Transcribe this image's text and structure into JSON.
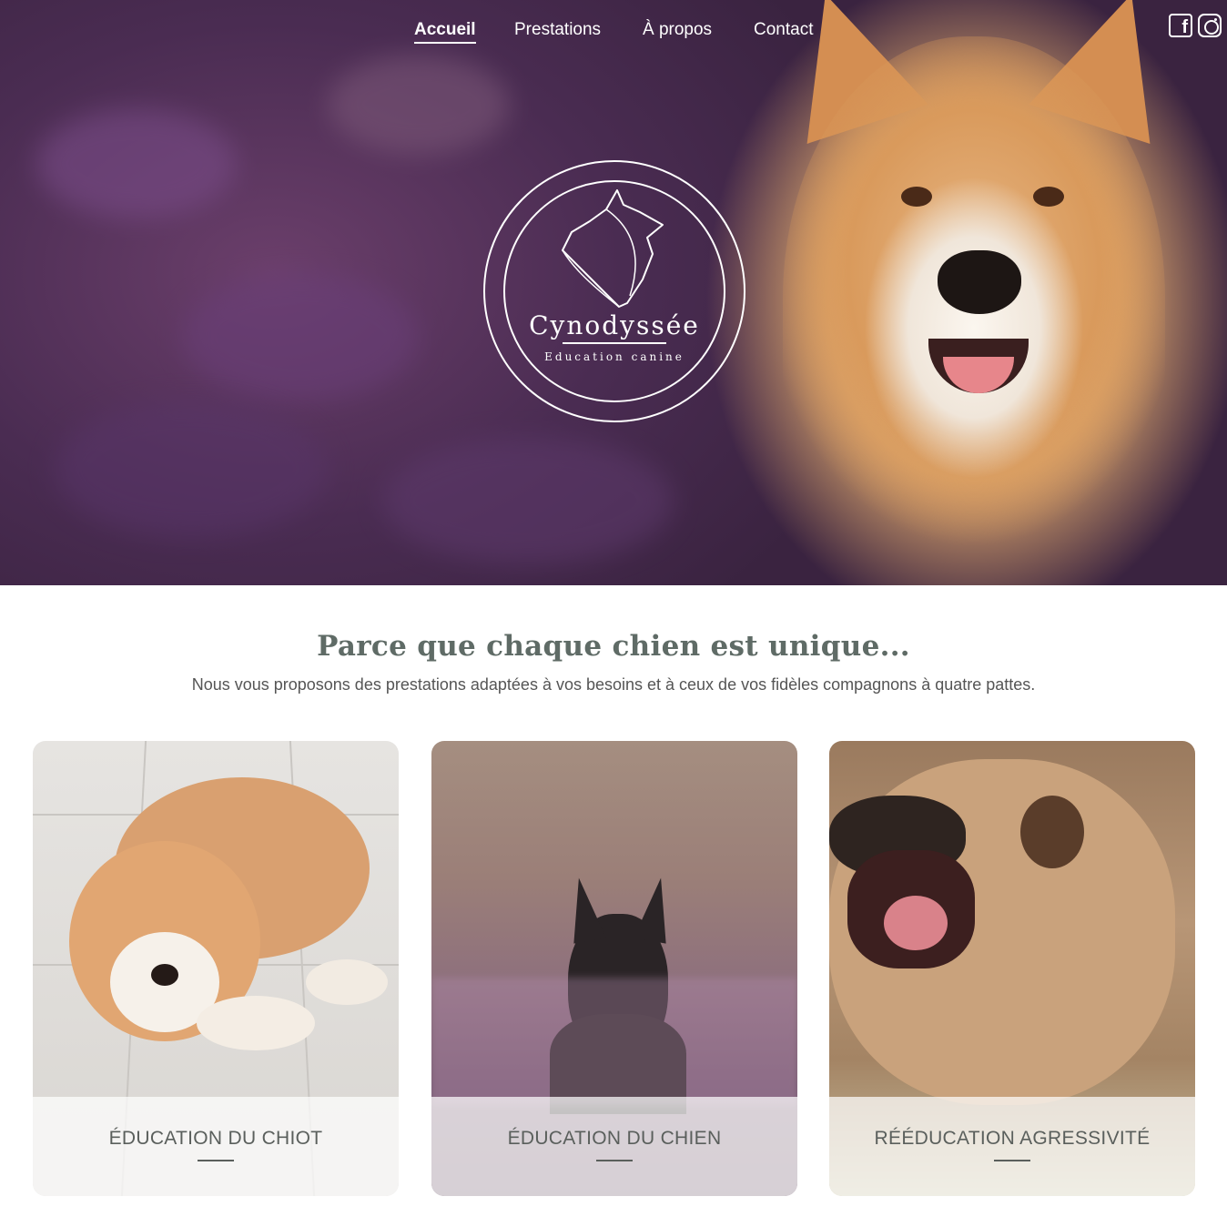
{
  "nav": {
    "items": [
      {
        "label": "Accueil",
        "active": true
      },
      {
        "label": "Prestations",
        "active": false
      },
      {
        "label": "À propos",
        "active": false
      },
      {
        "label": "Contact",
        "active": false
      }
    ],
    "social": [
      "facebook-icon",
      "instagram-icon"
    ]
  },
  "logo": {
    "name": "Cynodyssée",
    "tagline": "Education canine"
  },
  "intro": {
    "title": "Parce que chaque chien est unique...",
    "text": "Nous vous proposons des prestations adaptées à vos besoins et à ceux de vos fidèles compagnons à quatre pattes."
  },
  "cards": [
    {
      "label": "ÉDUCATION DU CHIOT"
    },
    {
      "label": "ÉDUCATION DU CHIEN"
    },
    {
      "label": "RÉÉDUCATION AGRESSIVITÉ"
    }
  ],
  "colors": {
    "accent_text": "#5f6b66",
    "nav_text": "#ffffff"
  }
}
